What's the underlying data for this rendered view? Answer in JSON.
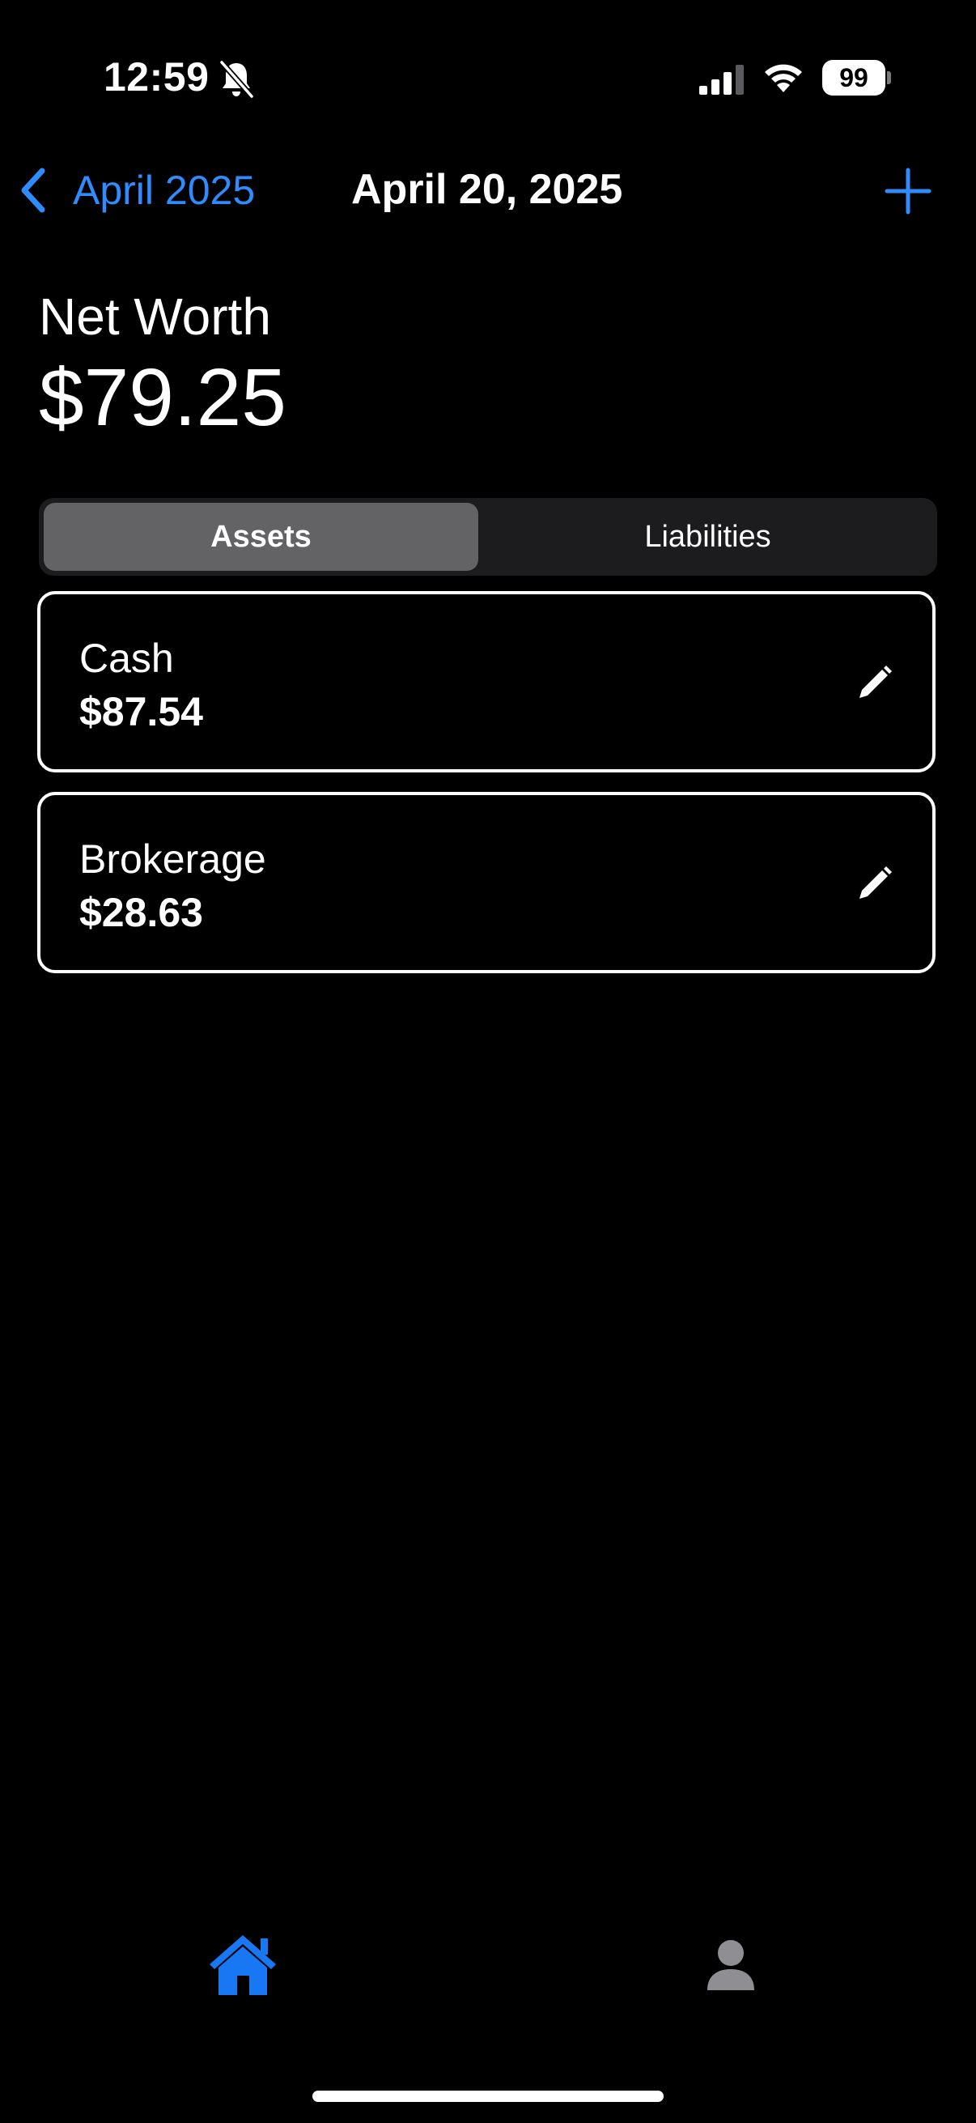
{
  "status_bar": {
    "time": "12:59",
    "battery_level": "99",
    "icons": [
      "bell-slash-icon",
      "cellular-signal-icon",
      "wifi-icon",
      "battery-icon"
    ]
  },
  "nav": {
    "back_label": "April 2025",
    "title": "April 20, 2025",
    "add_icon": "plus-icon"
  },
  "net_worth": {
    "label": "Net Worth",
    "value": "$79.25"
  },
  "segments": {
    "assets_label": "Assets",
    "liabilities_label": "Liabilities",
    "selected": "Assets"
  },
  "accounts": [
    {
      "name": "Cash",
      "value": "$87.54",
      "icon": "pencil-icon"
    },
    {
      "name": "Brokerage",
      "value": "$28.63",
      "icon": "pencil-icon"
    }
  ],
  "tab_bar": {
    "items": [
      {
        "icon": "house-icon",
        "selected": true
      },
      {
        "icon": "person-icon",
        "selected": false
      }
    ]
  },
  "colors": {
    "accent": "#2f8cff",
    "background": "#000000",
    "segment_bg": "#1c1c1e",
    "segment_selected": "#636366",
    "tab_inactive": "#8e8e93"
  }
}
